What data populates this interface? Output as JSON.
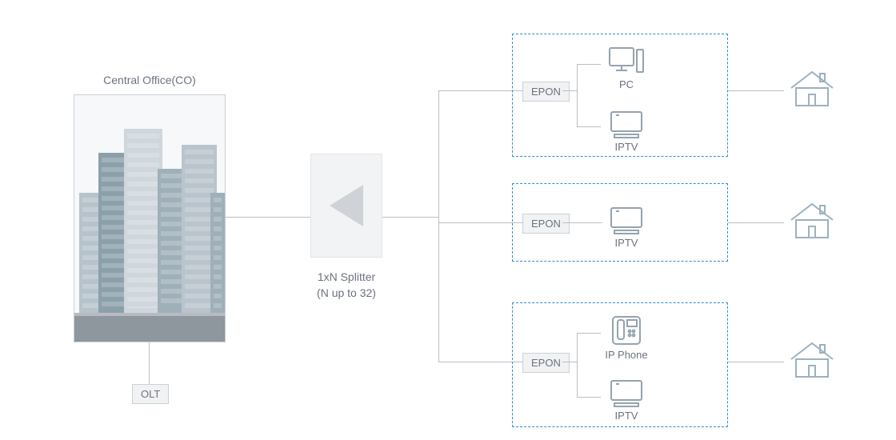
{
  "central_office": {
    "title": "Central Office(CO)"
  },
  "olt": {
    "label": "OLT"
  },
  "splitter": {
    "title": "1xN Splitter",
    "subtitle": "(N up to 32)"
  },
  "groups": {
    "top": {
      "epon_label": "EPON",
      "device1_label": "PC",
      "device2_label": "IPTV"
    },
    "middle": {
      "epon_label": "EPON",
      "device1_label": "IPTV"
    },
    "bottom": {
      "epon_label": "EPON",
      "device1_label": "IP Phone",
      "device2_label": "IPTV"
    }
  }
}
